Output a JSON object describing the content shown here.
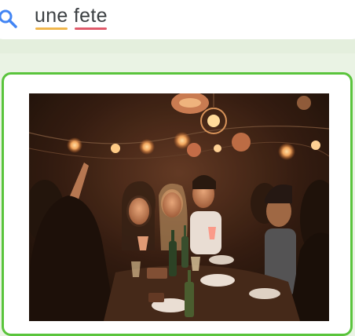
{
  "search": {
    "icon": "search-icon",
    "query_words": [
      "une",
      "fete"
    ],
    "icon_color": "#4285f4",
    "underline_colors": [
      "#f0b64c",
      "#e05a6a"
    ]
  },
  "result": {
    "border_color": "#5ac43c",
    "image_subject": "party-photo"
  }
}
